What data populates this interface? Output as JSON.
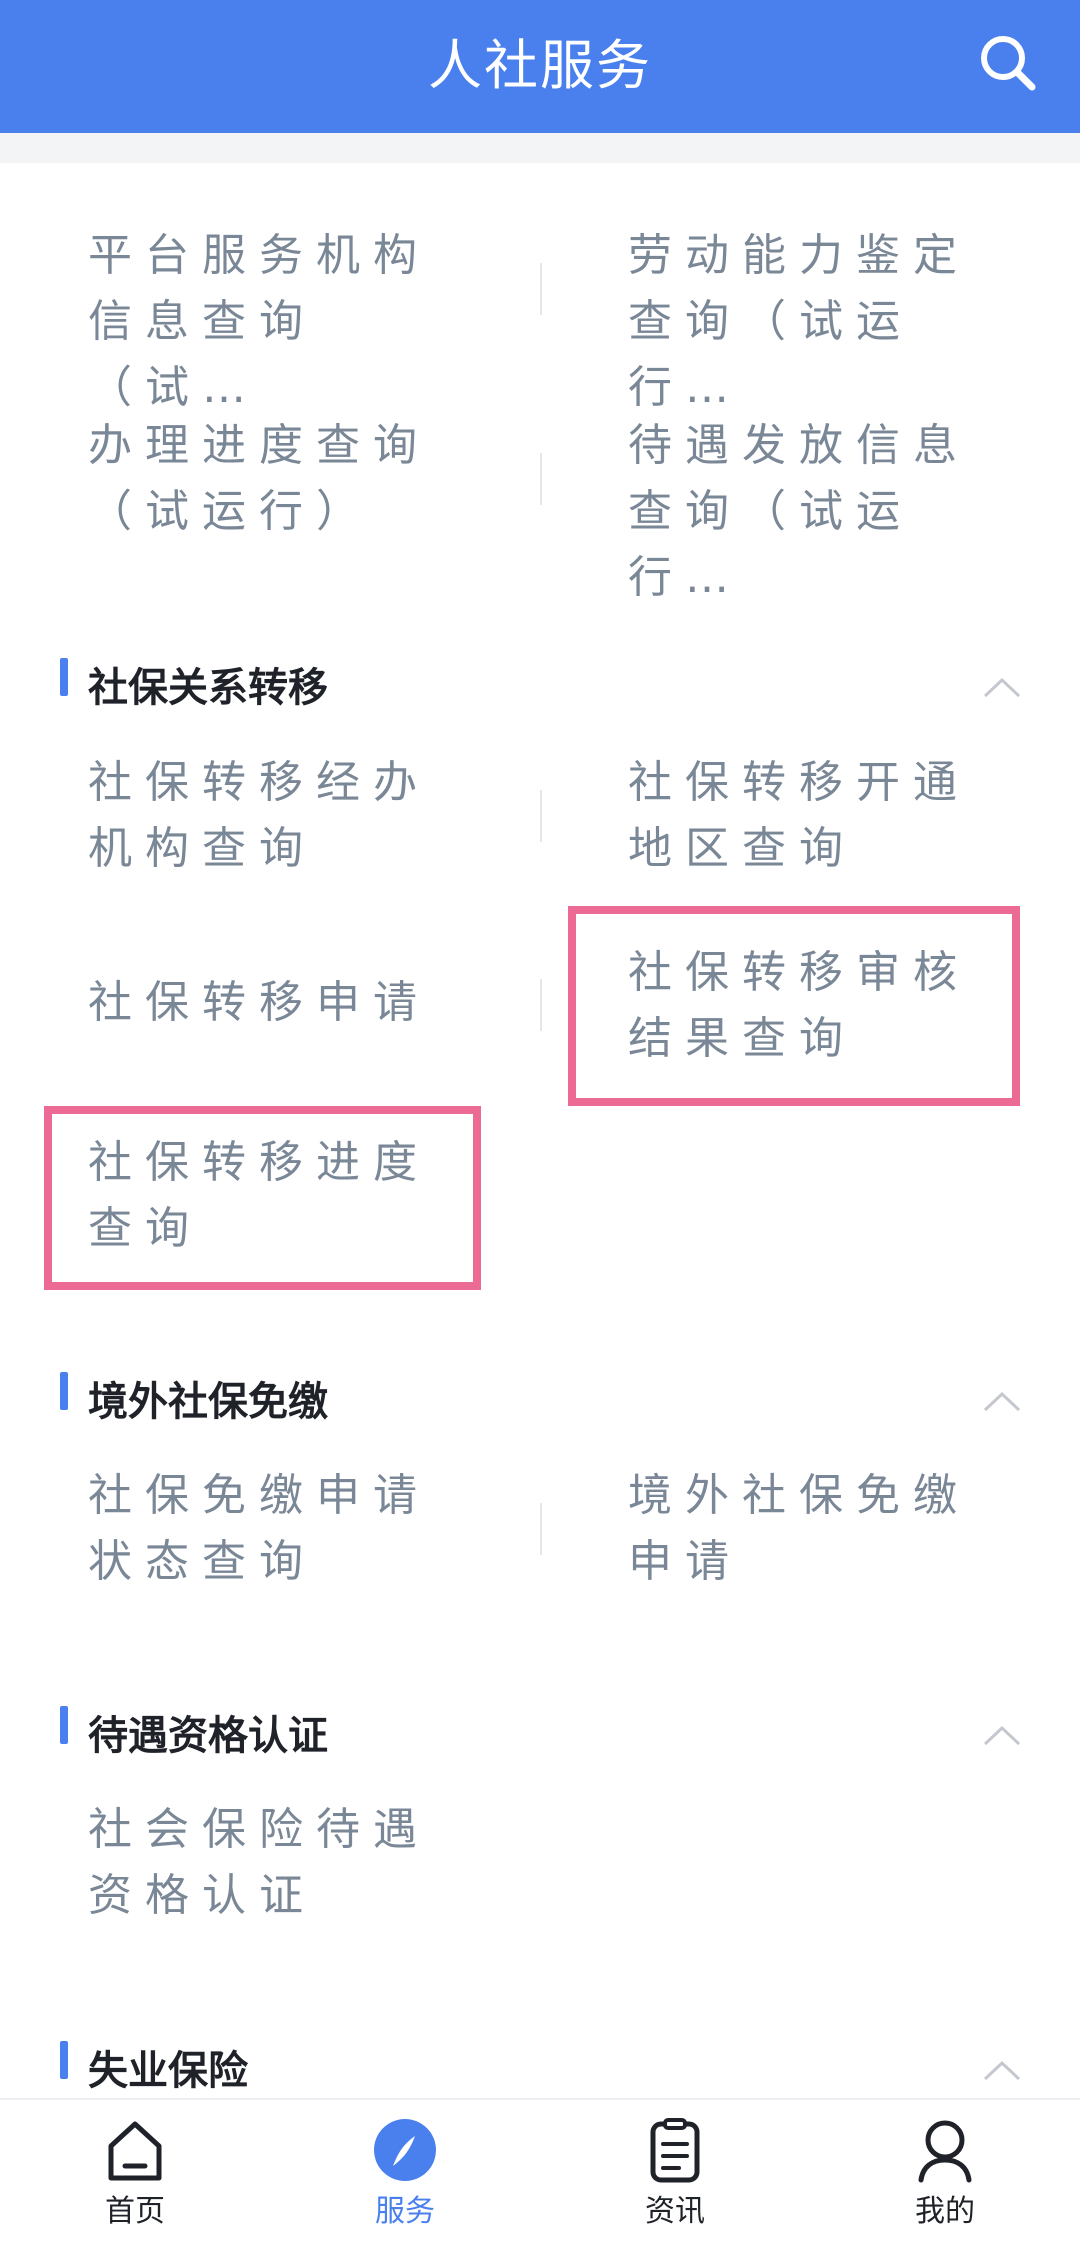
{
  "header": {
    "title": "人社服务",
    "search_icon": "search-icon"
  },
  "top_group": {
    "items": [
      "平台服务机构\n信息查询（试…",
      "劳动能力鉴定\n查询（试运行…",
      "办理进度查询\n（试运行）",
      "待遇发放信息\n查询（试运行…"
    ]
  },
  "sections": [
    {
      "title": "社保关系转移",
      "items": [
        "社保转移经办\n机构查询",
        "社保转移开通\n地区查询",
        "社保转移申请",
        "社保转移审核\n结果查询",
        "社保转移进度\n查询"
      ]
    },
    {
      "title": "境外社保免缴",
      "items": [
        "社保免缴申请\n状态查询",
        "境外社保免缴\n申请"
      ]
    },
    {
      "title": "待遇资格认证",
      "items": [
        "社会保险待遇\n资格认证"
      ]
    },
    {
      "title": "失业保险",
      "items": []
    }
  ],
  "tabbar": {
    "tabs": [
      {
        "label": "首页",
        "icon": "home-icon"
      },
      {
        "label": "服务",
        "icon": "compass-icon",
        "active": true
      },
      {
        "label": "资讯",
        "icon": "news-icon"
      },
      {
        "label": "我的",
        "icon": "profile-icon"
      }
    ]
  },
  "colors": {
    "primary": "#4a80ee",
    "highlight_box": "#ec6b95",
    "item_text": "#7a8796",
    "section_title": "#1f2329"
  }
}
